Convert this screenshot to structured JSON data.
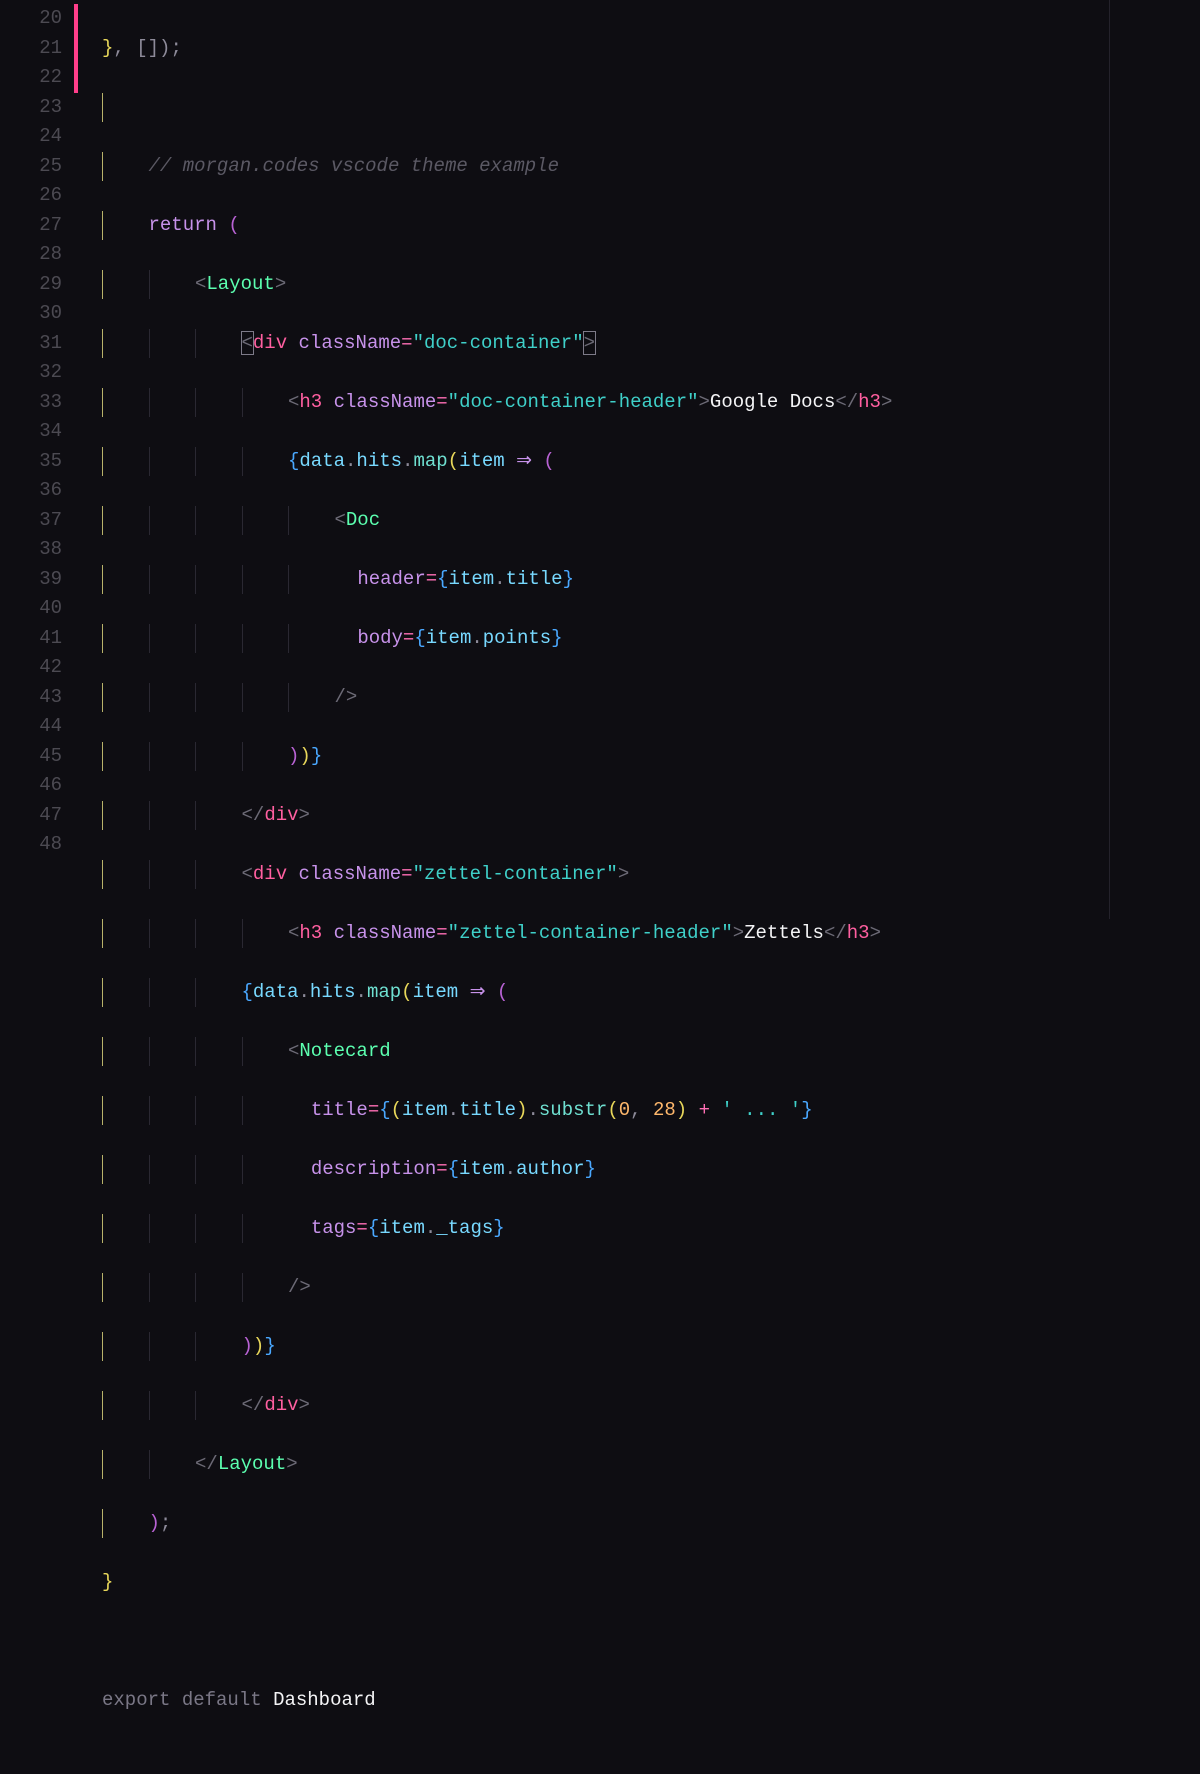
{
  "line_numbers": [
    "20",
    "21",
    "22",
    "23",
    "24",
    "25",
    "26",
    "27",
    "28",
    "29",
    "30",
    "31",
    "32",
    "33",
    "34",
    "35",
    "36",
    "37",
    "38",
    "39",
    "40",
    "41",
    "42",
    "43",
    "44",
    "45",
    "46",
    "47",
    "48"
  ],
  "code": {
    "l20": {
      "text": "}, []);",
      "tokens": []
    },
    "l22_comment": "// morgan.codes vscode theme example",
    "l23_return": "return",
    "l24_layout": "Layout",
    "l25": {
      "tag": "div",
      "attr": "className",
      "val": "doc-container"
    },
    "l26": {
      "tag": "h3",
      "attr": "className",
      "val": "doc-container-header",
      "text": "Google Docs"
    },
    "l27": {
      "obj": "data",
      "p1": "hits",
      "m": "map",
      "arg": "item"
    },
    "l28": {
      "comp": "Doc"
    },
    "l29": {
      "attr": "header",
      "obj": "item",
      "prop": "title"
    },
    "l30": {
      "attr": "body",
      "obj": "item",
      "prop": "points"
    },
    "l33": {
      "tag": "div"
    },
    "l34": {
      "tag": "div",
      "attr": "className",
      "val": "zettel-container"
    },
    "l35": {
      "tag": "h3",
      "attr": "className",
      "val": "zettel-container-header",
      "text": "Zettels"
    },
    "l36": {
      "obj": "data",
      "p1": "hits",
      "m": "map",
      "arg": "item"
    },
    "l37": {
      "comp": "Notecard"
    },
    "l38": {
      "attr": "title",
      "obj": "item",
      "prop": "title",
      "m": "substr",
      "n1": "0",
      "n2": "28",
      "tail": "' ... '"
    },
    "l39": {
      "attr": "description",
      "obj": "item",
      "prop": "author"
    },
    "l40": {
      "attr": "tags",
      "obj": "item",
      "prop": "_tags"
    },
    "l43": {
      "tag": "div"
    },
    "l44": {
      "comp": "Layout"
    },
    "l48": {
      "k1": "export",
      "k2": "default",
      "name": "Dashboard"
    }
  }
}
